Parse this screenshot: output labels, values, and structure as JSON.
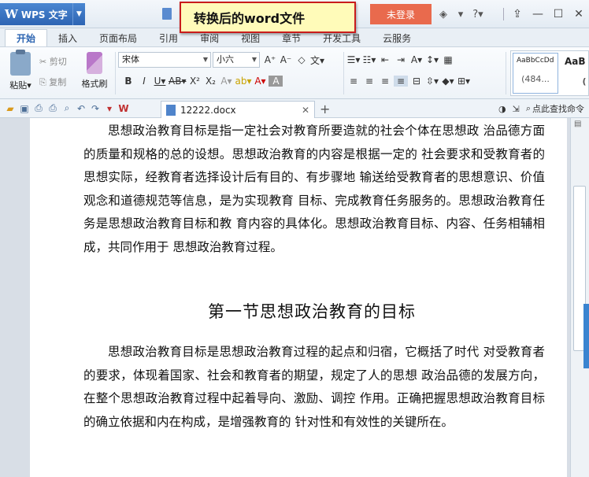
{
  "titlebar": {
    "app_name": "WPS 文字",
    "app_logo": "W",
    "banner": "转换后的word文件",
    "login_button": "未登录",
    "icons": [
      "skin-icon",
      "shirt-icon",
      "help-icon",
      "restore-icon",
      "minimize-icon",
      "maximize-icon",
      "close-icon"
    ],
    "icon_glyphs": [
      "◆",
      "👕",
      "?",
      "⇧",
      "—",
      "☐",
      "✕"
    ]
  },
  "ribbon_tabs": [
    "开始",
    "插入",
    "页面布局",
    "引用",
    "审阅",
    "视图",
    "章节",
    "开发工具",
    "云服务"
  ],
  "ribbon": {
    "paste": "粘贴",
    "cut": "剪切",
    "copy": "复制",
    "format_painter": "格式刷",
    "font_name": "宋体",
    "font_size": "小六",
    "style_sample_1": "AaBbCcDd",
    "style_sample_1_sub": "(484...",
    "style_sample_2": "AaB",
    "style_sample_2_sub": "("
  },
  "quickbar": {
    "doc_tab": "12222.docx",
    "find_command": "点此查找命令"
  },
  "document": {
    "para1": "思想政治教育目标是指一定社会对教育所要造就的社会个体在思想政 治品德方面的质量和规格的总的设想。思想政治教育的内容是根据一定的 社会要求和受教育者的思想实际，经教育者选择设计后有目的、有步骤地 输送给受教育者的思想意识、价值观念和道德规范等信息，是为实现教育 目标、完成教育任务服务的。思想政治教育任务是思想政治教育目标和教 育内容的具体化。思想政治教育目标、内容、任务相辅相成，共同作用于 思想政治教育过程。",
    "heading": "第一节思想政治教育的目标",
    "para2": "思想政治教育目标是思想政治教育过程的起点和归宿，它概括了时代 对受教育者的要求，体现着国家、社会和教育者的期望，规定了人的思想 政治品德的发展方向，在整个思想政治教育过程中起着导向、激励、调控 作用。正确把握思想政治教育目标的确立依据和内在构成，是增强教育的 针对性和有效性的关键所在。"
  },
  "colors": {
    "accent": "#2d64b3",
    "login": "#e96a4d",
    "banner_border": "#c91c1c",
    "banner_bg": "#fffbb9"
  }
}
